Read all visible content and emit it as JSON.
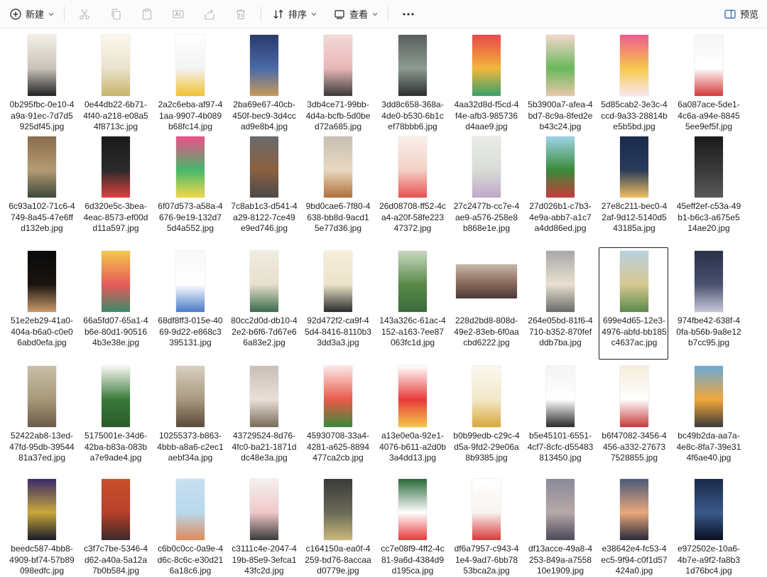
{
  "toolbar": {
    "new_label": "新建",
    "sort_label": "排序",
    "view_label": "查看",
    "preview_label": "预览"
  },
  "files": [
    {
      "name": "0b295fbc-0e10-4a9a-91ec-7d7d5925df45.jpg",
      "colors": [
        "#f3efe7",
        "#c9c3b8",
        "#222222"
      ]
    },
    {
      "name": "0e44db22-6b71-4f40-a218-e08a54f8713c.jpg",
      "colors": [
        "#fbf7ec",
        "#e9e2cc",
        "#c8b46a"
      ]
    },
    {
      "name": "2a2c6eba-af97-41aa-9907-4b089b68fc14.jpg",
      "colors": [
        "#ffffff",
        "#f3f3f3",
        "#f2c230"
      ]
    },
    {
      "name": "2ba69e67-40cb-450f-bec9-3d4ccad9e8b4.jpg",
      "colors": [
        "#2a3b6a",
        "#4a6aa8",
        "#c89a5a"
      ]
    },
    {
      "name": "3db4ce71-99bb-4d4a-bcfb-5d0bed72a685.jpg",
      "colors": [
        "#f4d8d8",
        "#e8b7b7",
        "#3a3a3a"
      ]
    },
    {
      "name": "3dd8c658-368a-4de0-b530-6b1cef78bbb6.jpg",
      "colors": [
        "#5b5f5c",
        "#8d9a93",
        "#2c2f2d"
      ]
    },
    {
      "name": "4aa32d8d-f5cd-4f4e-afb3-985736d4aae9.jpg",
      "colors": [
        "#e8484c",
        "#f2b73a",
        "#3aa06c"
      ]
    },
    {
      "name": "5b3900a7-afea-4bd7-8c9a-8fed2eb43c24.jpg",
      "colors": [
        "#f2d7cc",
        "#6bb85c",
        "#e8c8a8"
      ]
    },
    {
      "name": "5d85cab2-3e3c-4ccd-9a33-28814be5b5bd.jpg",
      "colors": [
        "#f05a8f",
        "#f5c94a",
        "#f8e8ee"
      ]
    },
    {
      "name": "6a087ace-5de1-4c6a-a94e-88455ee9ef5f.jpg",
      "colors": [
        "#f6f6f6",
        "#ffffff",
        "#d43a3a"
      ]
    },
    {
      "name": "6c93a102-71c6-4749-8a45-47e6ffd132eb.jpg",
      "colors": [
        "#8a6d4c",
        "#b49a72",
        "#3a4a3a"
      ]
    },
    {
      "name": "6d320e5c-3bea-4eac-8573-ef00dd11a597.jpg",
      "colors": [
        "#1a1a1a",
        "#2a2a2a",
        "#e04040"
      ]
    },
    {
      "name": "6f07d573-a58a-4676-9e19-132d75d4a552.jpg",
      "colors": [
        "#ee4f8c",
        "#46b86a",
        "#f2d84a"
      ]
    },
    {
      "name": "7c8ab1c3-d541-4a29-8122-7ce49e9ed746.jpg",
      "colors": [
        "#6a6a6a",
        "#8a6040",
        "#4a4a4a"
      ]
    },
    {
      "name": "9bd0cae6-7f80-4638-bb8d-9acd15e77d36.jpg",
      "colors": [
        "#c8c0b4",
        "#e8d8c0",
        "#b0703a"
      ]
    },
    {
      "name": "26d08708-ff52-4ca4-a20f-58fe22347372.jpg",
      "colors": [
        "#f8f0ea",
        "#f2d0c4",
        "#e85050"
      ]
    },
    {
      "name": "27c2477b-cc7e-4ae9-a576-258e8b868e1e.jpg",
      "colors": [
        "#eaece8",
        "#d8dcd6",
        "#c0a8c8"
      ]
    },
    {
      "name": "27d026b1-c7b3-4e9a-abb7-a1c7a4dd86ed.jpg",
      "colors": [
        "#9fd4e8",
        "#3a8a3a",
        "#c83a3a"
      ]
    },
    {
      "name": "27e8c211-bec0-42af-9d12-5140d543185a.jpg",
      "colors": [
        "#1a2a4a",
        "#2a3a5a",
        "#f0c060"
      ]
    },
    {
      "name": "45eff2ef-c53a-49b1-b6c3-a675e514ae20.jpg",
      "colors": [
        "#1a1a1a",
        "#3a3a3a",
        "#5a5a5a"
      ]
    },
    {
      "name": "51e2eb29-41a0-404a-b6a0-c0e06abd0efa.jpg",
      "colors": [
        "#0a0a0a",
        "#1a1410",
        "#c89a6a"
      ]
    },
    {
      "name": "66a5fd07-65a1-4b6e-80d1-905164b3e38e.jpg",
      "colors": [
        "#f2c84a",
        "#e85a5a",
        "#3a8a6a"
      ]
    },
    {
      "name": "68df8ff3-015e-4069-9d22-e868c3395131.jpg",
      "colors": [
        "#f8f8f8",
        "#ffffff",
        "#4a7ac8"
      ]
    },
    {
      "name": "80cc2d0d-db10-42e2-b6f6-7d67e66a83e2.jpg",
      "colors": [
        "#f0ece0",
        "#e6e0cc",
        "#3a6a4a"
      ]
    },
    {
      "name": "92d472f2-ca9f-45d4-8416-8110b33dd3a3.jpg",
      "colors": [
        "#f4eedc",
        "#ece4c8",
        "#2a2a2a"
      ]
    },
    {
      "name": "143a326c-61ac-4152-a163-7ee87063fc1d.jpg",
      "colors": [
        "#c8d8c0",
        "#5a8a4a",
        "#3a6a3a"
      ]
    },
    {
      "name": "228d2bd8-808d-49e2-83eb-6f0aacbd6222.jpg",
      "colors": [
        "#c8b8a8",
        "#8a6a5a",
        "#4a3a3a"
      ]
    },
    {
      "name": "264e05bd-81f6-4710-b352-870fefddb7ba.jpg",
      "colors": [
        "#a8a8a8",
        "#e8e0d0",
        "#6a6a6a"
      ]
    },
    {
      "name": "699e4d65-12e3-4976-abfd-bb185c4637ac.jpg",
      "colors": [
        "#b8d0e0",
        "#d8c890",
        "#5a8a4a"
      ]
    },
    {
      "name": "974fbe42-638f-40fa-b56b-9a8e12b7cc95.jpg",
      "colors": [
        "#2a3048",
        "#4a5070",
        "#c8c8d8"
      ]
    },
    {
      "name": "52422ab8-13ed-47fd-95db-3954481a37ed.jpg",
      "colors": [
        "#c8c0a8",
        "#a89878",
        "#6a5a4a"
      ]
    },
    {
      "name": "5175001e-34d6-42ba-b83a-083ba7e9ade4.jpg",
      "colors": [
        "#f8f8f4",
        "#3a7a3a",
        "#2a5a2a"
      ]
    },
    {
      "name": "10255373-b863-4bbb-a8a6-c2ec1aebf34a.jpg",
      "colors": [
        "#d8d0c0",
        "#a89880",
        "#5a4a3a"
      ]
    },
    {
      "name": "43729524-8d76-4fc0-ba21-1871ddc48e3a.jpg",
      "colors": [
        "#c8c0b8",
        "#e8e0d8",
        "#7a6a5a"
      ]
    },
    {
      "name": "45930708-33a4-4281-a625-8894477ca2cb.jpg",
      "colors": [
        "#fce8e8",
        "#e85a4a",
        "#3a8a3a"
      ]
    },
    {
      "name": "a13e0e0a-92e1-4076-b611-a2d0b3a4dd13.jpg",
      "colors": [
        "#ffffff",
        "#e83a3a",
        "#f2c84a"
      ]
    },
    {
      "name": "b0b99edb-c29c-4d5a-9fd2-29e06a8b9385.jpg",
      "colors": [
        "#fbf8f0",
        "#f2e8c8",
        "#d8a83a"
      ]
    },
    {
      "name": "b5e45101-6551-4cf7-8cfc-d55483813450.jpg",
      "colors": [
        "#f4f4f4",
        "#ffffff",
        "#2a2a2a"
      ]
    },
    {
      "name": "b6f47082-3456-4456-a332-276737528855.jpg",
      "colors": [
        "#f4ecd8",
        "#ffffff",
        "#c83a3a"
      ]
    },
    {
      "name": "bc49b2da-aa7a-4e8c-8fa7-39e314f6ae40.jpg",
      "colors": [
        "#6aa8d8",
        "#f2a83a",
        "#3a3a3a"
      ]
    },
    {
      "name": "beedc587-4bb8-4909-bf74-57b89098edfc.jpg",
      "colors": [
        "#3a2a6a",
        "#c8a83a",
        "#1a1a2a"
      ]
    },
    {
      "name": "c3f7c7be-5346-4d62-a40a-5a12a7b0b584.jpg",
      "colors": [
        "#c8502a",
        "#b8402a",
        "#3a2a2a"
      ]
    },
    {
      "name": "c6b0c0cc-0a9e-4d6c-8c6c-e30d216a18c6.jpg",
      "colors": [
        "#c8e0f0",
        "#b8d8ec",
        "#e08a5a"
      ]
    },
    {
      "name": "c3111c4e-2047-419b-85e9-3efca143fc2d.jpg",
      "colors": [
        "#f4f0f0",
        "#f0c8c8",
        "#3a3a3a"
      ]
    },
    {
      "name": "c164150a-ea0f-4259-bd76-8accaad0779e.jpg",
      "colors": [
        "#3a3a3a",
        "#6a6a5a",
        "#c8b878"
      ]
    },
    {
      "name": "cc7e08f9-4ff2-4c81-9a6d-4384d9d195ca.jpg",
      "colors": [
        "#2a6a3a",
        "#ffffff",
        "#e83a3a"
      ]
    },
    {
      "name": "df6a7957-c943-41e4-9ad7-6bb7853bca2a.jpg",
      "colors": [
        "#ffffff",
        "#f8f4f0",
        "#d83a3a"
      ]
    },
    {
      "name": "df13acce-49a8-4253-849a-a755810e1909.jpg",
      "colors": [
        "#8a8a9a",
        "#b8a8a8",
        "#4a4a5a"
      ]
    },
    {
      "name": "e38642e4-fc53-4ec5-9f94-c0f1d57424a0.jpg",
      "colors": [
        "#4a5a7a",
        "#e8a87a",
        "#2a2a3a"
      ]
    },
    {
      "name": "e972502e-10a6-4b7e-a9f2-fa8b31d76bc4.jpg",
      "colors": [
        "#1a2a4a",
        "#3a5a8a",
        "#0a1020"
      ]
    }
  ]
}
